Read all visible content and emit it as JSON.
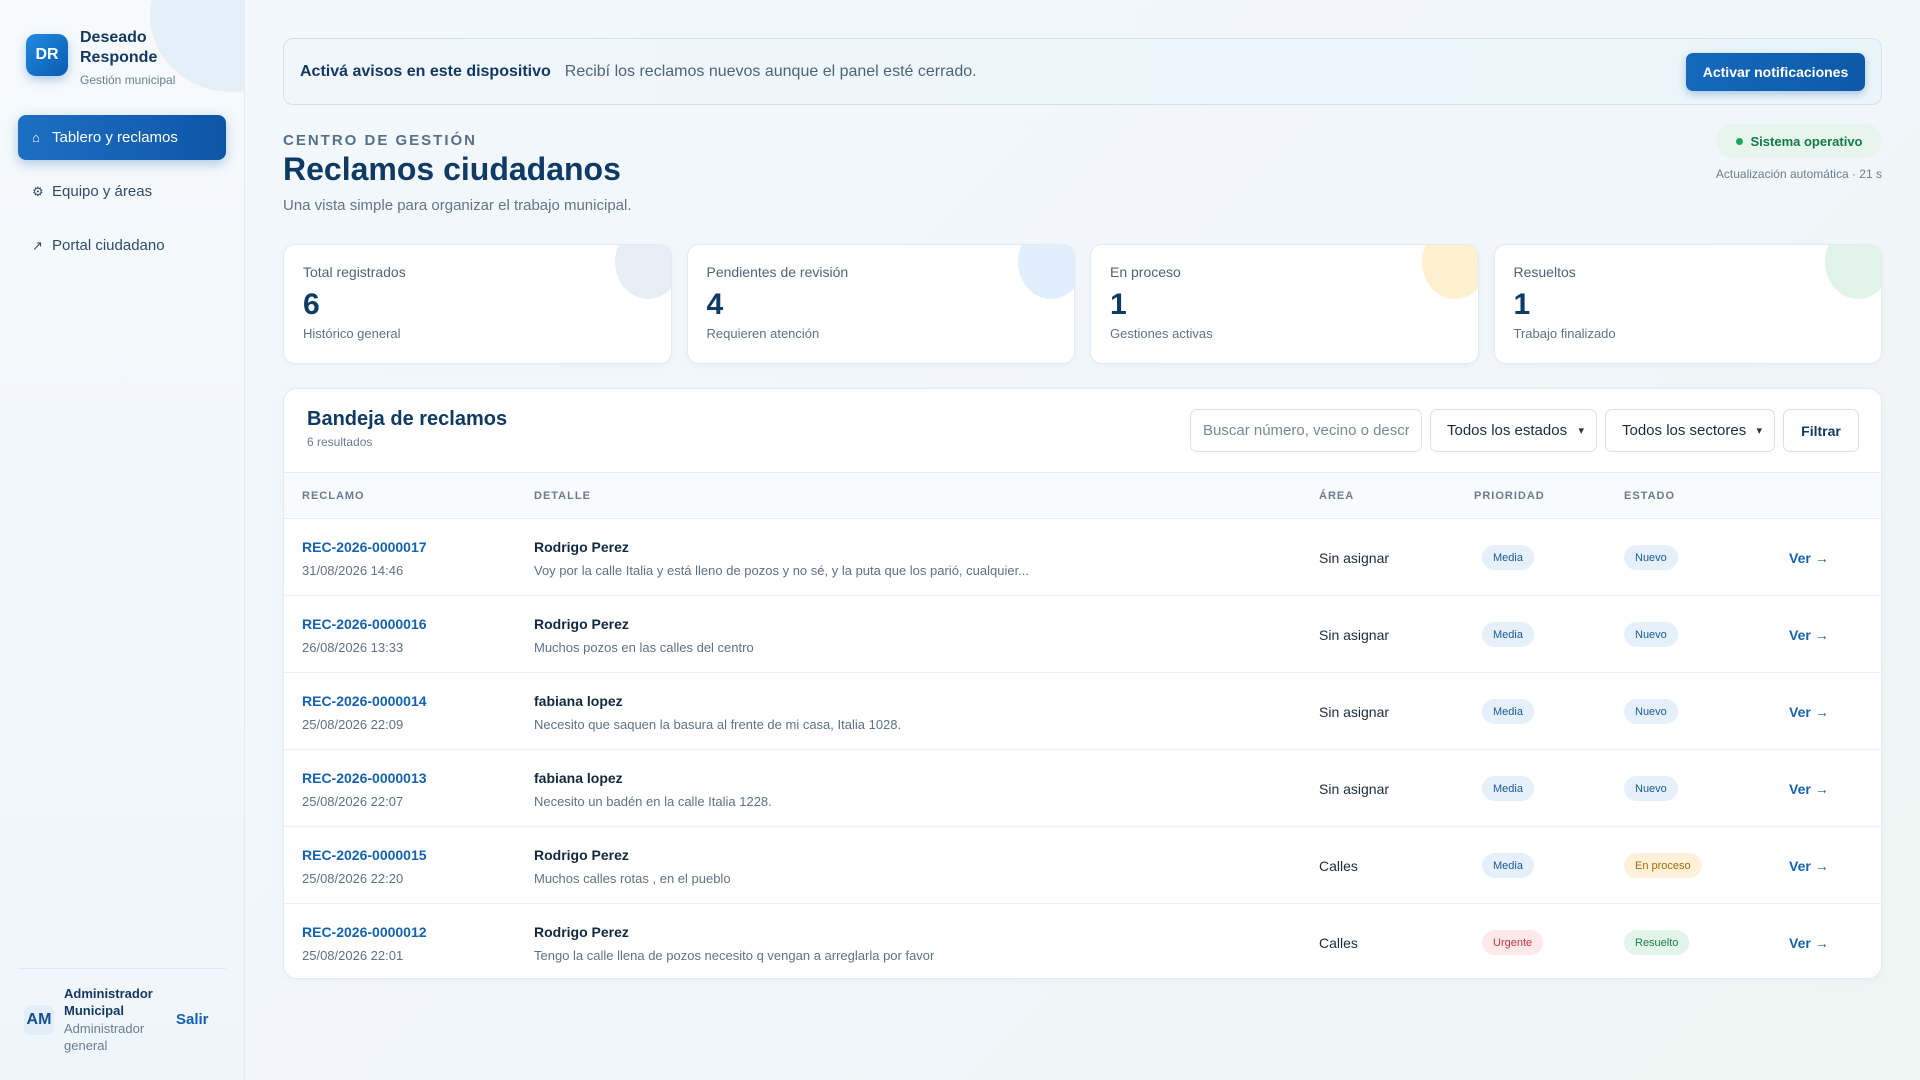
{
  "brand": {
    "logo": "DR",
    "name": "Deseado Responde",
    "subtitle": "Gestión municipal"
  },
  "nav": [
    {
      "icon": "⌂",
      "label": "Tablero y reclamos",
      "active": true
    },
    {
      "icon": "⚙",
      "label": "Equipo y áreas",
      "active": false
    },
    {
      "icon": "↗",
      "label": "Portal ciudadano",
      "active": false
    }
  ],
  "user": {
    "initials": "AM",
    "name": "Administrador Municipal",
    "role": "Administrador general",
    "logout": "Salir"
  },
  "notification": {
    "title": "Activá avisos en este dispositivo",
    "text": "Recibí los reclamos nuevos aunque el panel esté cerrado.",
    "button": "Activar notificaciones"
  },
  "header": {
    "eyebrow": "CENTRO DE GESTIÓN",
    "title": "Reclamos ciudadanos",
    "subtitle": "Una vista simple para organizar el trabajo municipal.",
    "status": "Sistema operativo",
    "auto_update": "Actualización automática · 21 s"
  },
  "stats": [
    {
      "label": "Total registrados",
      "value": "6",
      "note": "Histórico general",
      "accent": "#e8eef6"
    },
    {
      "label": "Pendientes de revisión",
      "value": "4",
      "note": "Requieren atención",
      "accent": "#e1eefb"
    },
    {
      "label": "En proceso",
      "value": "1",
      "note": "Gestiones activas",
      "accent": "#fdf0cf"
    },
    {
      "label": "Resueltos",
      "value": "1",
      "note": "Trabajo finalizado",
      "accent": "#e2f4ea"
    }
  ],
  "inbox": {
    "title": "Bandeja de reclamos",
    "count": "6 resultados",
    "search_placeholder": "Buscar número, vecino o descripción",
    "state_filter": "Todos los estados",
    "sector_filter": "Todos los sectores",
    "filter_button": "Filtrar",
    "columns": {
      "id": "RECLAMO",
      "detail": "DETALLE",
      "area": "ÁREA",
      "priority": "PRIORIDAD",
      "state": "ESTADO"
    },
    "view_label": "Ver →"
  },
  "rows": [
    {
      "id": "REC-2026-0000017",
      "date": "31/08/2026 14:46",
      "name": "Rodrigo Perez",
      "desc": "Voy por la calle Italia y está lleno de pozos y no sé, y la puta que los parió, cualquier...",
      "area": "Sin asignar",
      "priority": "Media",
      "priority_class": "b-media",
      "state": "Nuevo",
      "state_class": "b-nuevo"
    },
    {
      "id": "REC-2026-0000016",
      "date": "26/08/2026 13:33",
      "name": "Rodrigo Perez",
      "desc": "Muchos pozos en las calles del centro",
      "area": "Sin asignar",
      "priority": "Media",
      "priority_class": "b-media",
      "state": "Nuevo",
      "state_class": "b-nuevo"
    },
    {
      "id": "REC-2026-0000014",
      "date": "25/08/2026 22:09",
      "name": "fabiana lopez",
      "desc": "Necesito que saquen la basura al frente de mi casa, Italia 1028.",
      "area": "Sin asignar",
      "priority": "Media",
      "priority_class": "b-media",
      "state": "Nuevo",
      "state_class": "b-nuevo"
    },
    {
      "id": "REC-2026-0000013",
      "date": "25/08/2026 22:07",
      "name": "fabiana lopez",
      "desc": "Necesito un badén en la calle Italia 1228.",
      "area": "Sin asignar",
      "priority": "Media",
      "priority_class": "b-media",
      "state": "Nuevo",
      "state_class": "b-nuevo"
    },
    {
      "id": "REC-2026-0000015",
      "date": "25/08/2026 22:20",
      "name": "Rodrigo Perez",
      "desc": "Muchos calles rotas , en el pueblo",
      "area": "Calles",
      "priority": "Media",
      "priority_class": "b-media",
      "state": "En proceso",
      "state_class": "b-proceso"
    },
    {
      "id": "REC-2026-0000012",
      "date": "25/08/2026 22:01",
      "name": "Rodrigo Perez",
      "desc": "Tengo la calle llena de pozos necesito q vengan a arreglarla por favor",
      "area": "Calles",
      "priority": "Urgente",
      "priority_class": "b-urgente",
      "state": "Resuelto",
      "state_class": "b-resuelto"
    }
  ]
}
